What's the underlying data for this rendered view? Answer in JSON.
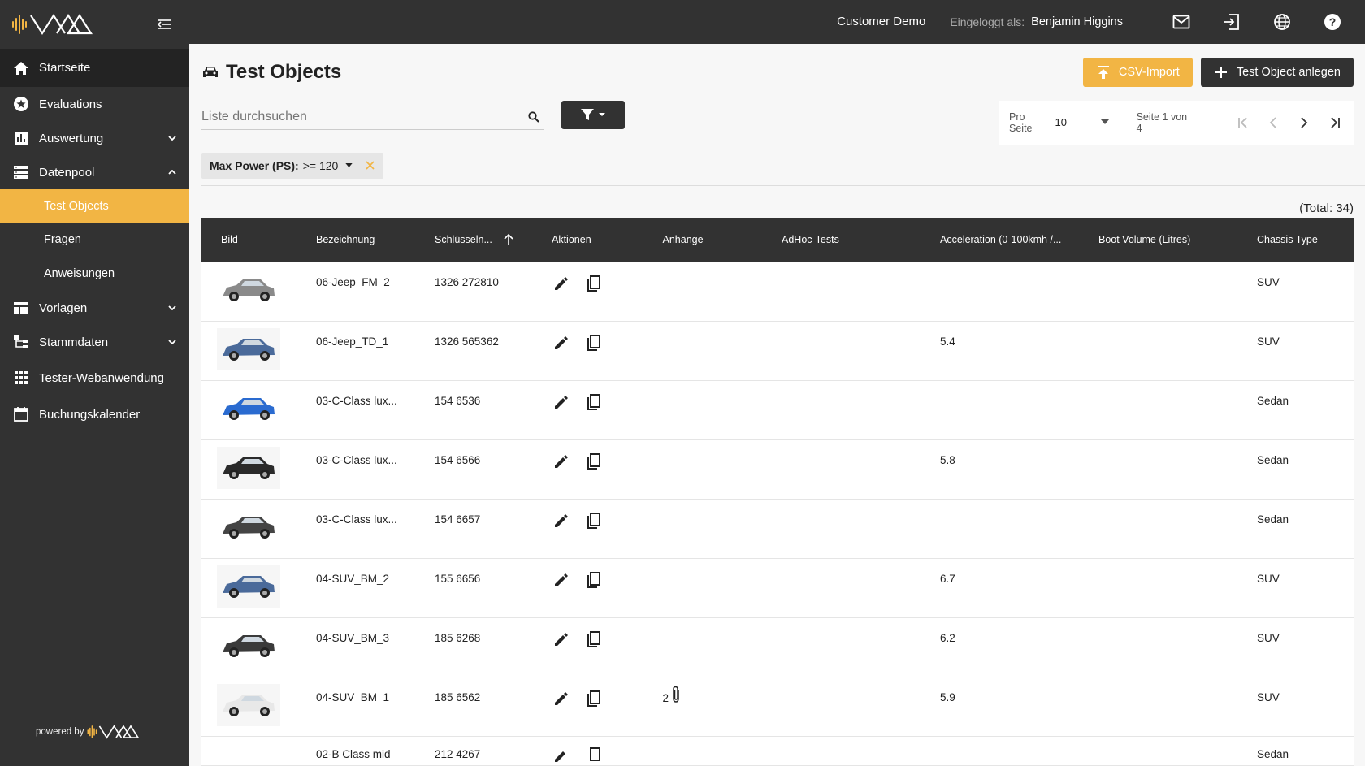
{
  "sidebar": {
    "items": [
      {
        "label": "Startseite",
        "icon": "home-icon"
      },
      {
        "label": "Evaluations",
        "icon": "star-circle-icon"
      },
      {
        "label": "Auswertung",
        "icon": "bar-chart-icon"
      },
      {
        "label": "Datenpool",
        "icon": "storage-icon"
      },
      {
        "label": "Vorlagen",
        "icon": "template-icon"
      },
      {
        "label": "Stammdaten",
        "icon": "hierarchy-icon"
      },
      {
        "label": "Tester-Webanwendung",
        "icon": "apps-grid-icon"
      },
      {
        "label": "Buchungskalender",
        "icon": "calendar-icon"
      }
    ],
    "sub_items": [
      "Test Objects",
      "Fragen",
      "Anweisungen"
    ],
    "powered_by": "powered by"
  },
  "topbar": {
    "customer": "Customer Demo",
    "logged_in_label": "Eingeloggt als:",
    "user": "Benjamin Higgins"
  },
  "page": {
    "title": "Test Objects",
    "csv_button": "CSV-Import",
    "add_button": "Test Object anlegen"
  },
  "search": {
    "placeholder": "Liste durchsuchen"
  },
  "pager": {
    "per_page_label": "Pro Seite",
    "per_page_value": "10",
    "page_info": "Seite 1 von 4"
  },
  "filter_chip": {
    "field": "Max Power (PS):",
    "value": ">= 120"
  },
  "total": "(Total: 34)",
  "table": {
    "columns": [
      "Bild",
      "Bezeichnung",
      "Schlüsseln...",
      "Aktionen",
      "Anhänge",
      "AdHoc-Tests",
      "Acceleration (0-100kmh /...",
      "Boot Volume (Litres)",
      "Chassis Type"
    ],
    "rows": [
      {
        "name": "06-Jeep_FM_2",
        "key": "1326 272810",
        "attach": "",
        "accel": "",
        "chassis": "SUV",
        "car_color": "#8a8a8a",
        "bg": false
      },
      {
        "name": "06-Jeep_TD_1",
        "key": "1326 565362",
        "attach": "",
        "accel": "5.4",
        "chassis": "SUV",
        "car_color": "#4a6a9a",
        "bg": true
      },
      {
        "name": "03-C-Class lux...",
        "key": "154 6536",
        "attach": "",
        "accel": "",
        "chassis": "Sedan",
        "car_color": "#2a6bd0",
        "bg": false
      },
      {
        "name": "03-C-Class lux...",
        "key": "154 6566",
        "attach": "",
        "accel": "5.8",
        "chassis": "Sedan",
        "car_color": "#2a2a2a",
        "bg": true
      },
      {
        "name": "03-C-Class lux...",
        "key": "154 6657",
        "attach": "",
        "accel": "",
        "chassis": "Sedan",
        "car_color": "#444444",
        "bg": false
      },
      {
        "name": "04-SUV_BM_2",
        "key": "155 6656",
        "attach": "",
        "accel": "6.7",
        "chassis": "SUV",
        "car_color": "#4a6a9a",
        "bg": true
      },
      {
        "name": "04-SUV_BM_3",
        "key": "185 6268",
        "attach": "",
        "accel": "6.2",
        "chassis": "SUV",
        "car_color": "#3a3a3a",
        "bg": false
      },
      {
        "name": "04-SUV_BM_1",
        "key": "185 6562",
        "attach": "2",
        "accel": "5.9",
        "chassis": "SUV",
        "car_color": "#e8e8e8",
        "bg": true
      }
    ],
    "partial_row": {
      "name": "02-B Class mid",
      "key": "212 4267",
      "chassis": "Sedan"
    }
  },
  "colors": {
    "accent": "#f2b544",
    "dark": "#323232"
  }
}
